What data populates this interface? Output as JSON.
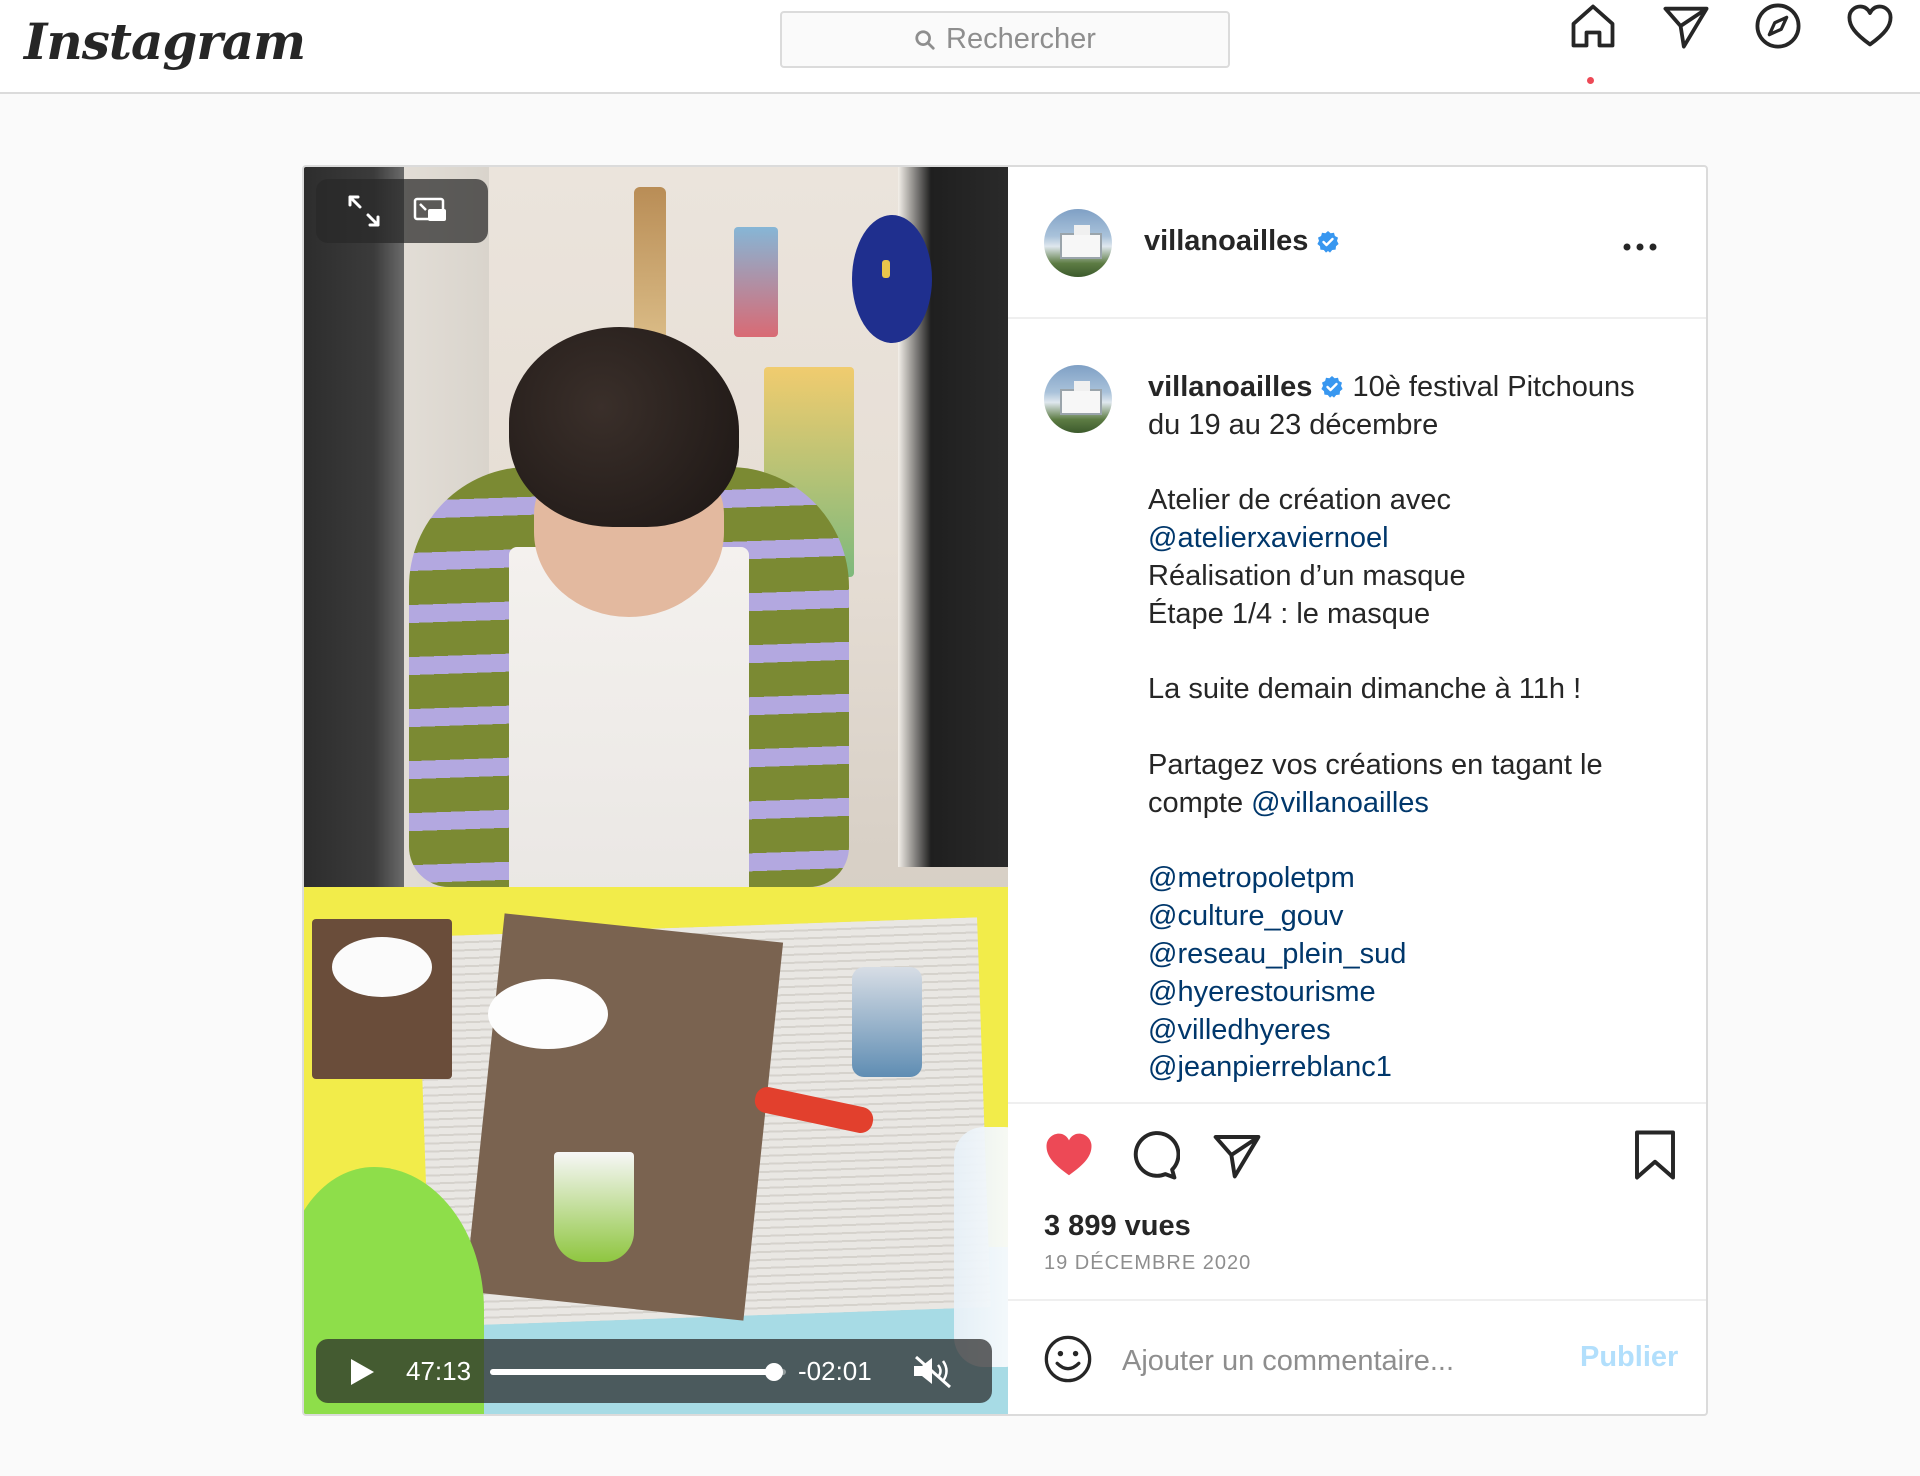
{
  "nav": {
    "logo": "Instagram",
    "search_placeholder": "Rechercher",
    "icons": [
      "home-icon",
      "direct-icon",
      "explore-icon",
      "activity-icon"
    ]
  },
  "post": {
    "username": "villanoailles",
    "verified": true,
    "video": {
      "elapsed": "47:13",
      "remaining": "-02:01",
      "progress_fraction": 0.96,
      "muted": true
    },
    "caption": {
      "username": "villanoailles",
      "line1": " 10è festival Pitchouns du 19 au 23 décembre",
      "p2a": "Atelier de création avec",
      "m_atelier": "@atelierxaviernoel",
      "p2b": "Réalisation d’un masque",
      "p2c": "Étape 1/4 : le masque",
      "p3": "La suite demain dimanche à 11h !",
      "p4": "Partagez vos créations en tagant le compte ",
      "m_villa": "@villanoailles",
      "m1": "@metropoletpm",
      "m2": "@culture_gouv",
      "m3": "@reseau_plein_sud",
      "m4": "@hyerestourisme",
      "m5": "@villedhyeres",
      "m6": "@jeanpierreblanc1"
    },
    "liked": true,
    "accent_like": "#ed4956",
    "views": "3 899 vues",
    "date": "19 DÉCEMBRE 2020",
    "comment_placeholder": "Ajouter un commentaire...",
    "publish_label": "Publier"
  },
  "colors": {
    "mention": "#00376b",
    "border": "#dbdbdb",
    "publish_disabled": "#b2dffc",
    "verified_blue": "#3897f0"
  }
}
